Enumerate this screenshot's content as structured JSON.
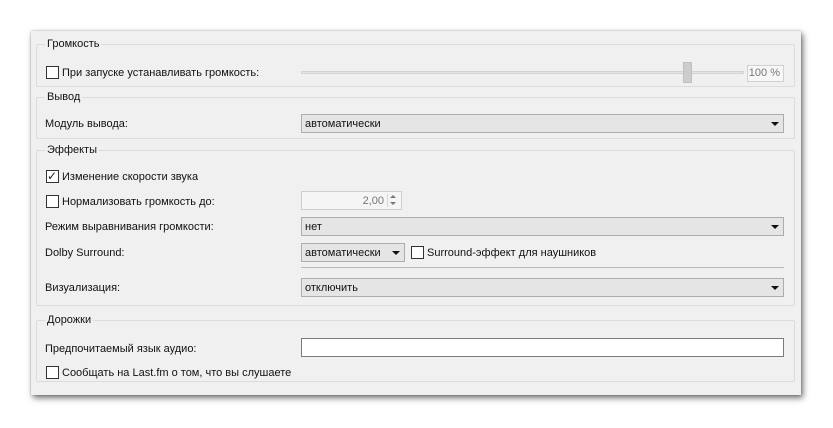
{
  "volume": {
    "title": "Громкость",
    "set_on_start_label": "При запуске устанавливать громкость:",
    "set_on_start_checked": false,
    "slider_value_percent": 88,
    "value_text": "100 %"
  },
  "output": {
    "title": "Вывод",
    "module_label": "Модуль вывода:",
    "module_value": "автоматически"
  },
  "effects": {
    "title": "Эффекты",
    "speed_change_label": "Изменение скорости звука",
    "speed_change_checked": true,
    "normalize_label": "Нормализовать громкость до:",
    "normalize_checked": false,
    "normalize_value": "2,00",
    "equalization_label": "Режим выравнивания громкости:",
    "equalization_value": "нет",
    "dolby_label": "Dolby Surround:",
    "dolby_value": "автоматически",
    "headphones_surround_label": "Surround-эффект для наушников",
    "headphones_surround_checked": false,
    "visualization_label": "Визуализация:",
    "visualization_value": "отключить"
  },
  "tracks": {
    "title": "Дорожки",
    "preferred_language_label": "Предпочитаемый язык аудио:",
    "preferred_language_value": "",
    "lastfm_label": "Сообщать на Last.fm о том, что вы слушаете",
    "lastfm_checked": false
  }
}
